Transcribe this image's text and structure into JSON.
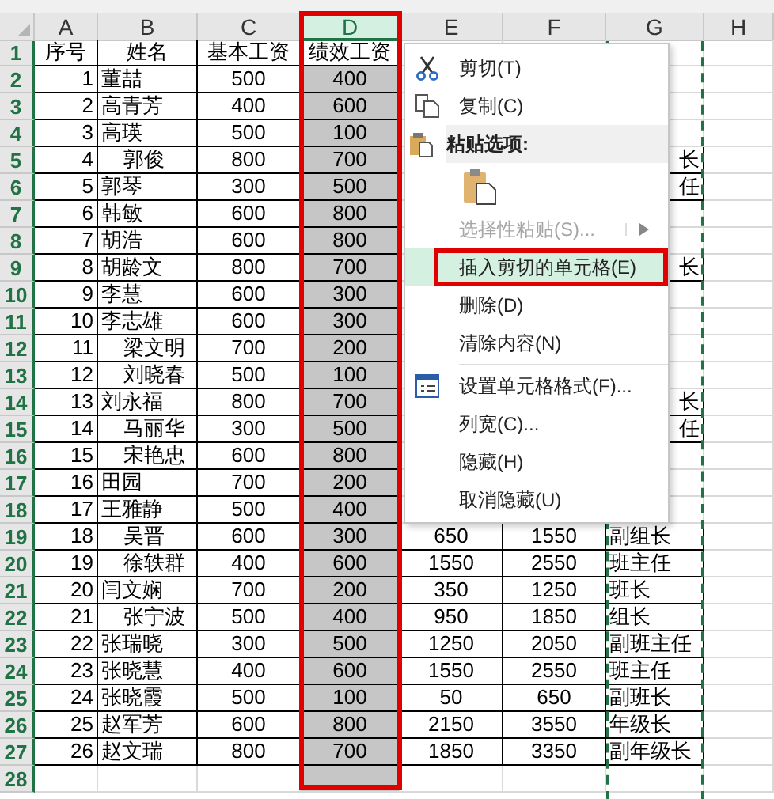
{
  "columns": [
    {
      "label": "A",
      "selected": false
    },
    {
      "label": "B",
      "selected": false
    },
    {
      "label": "C",
      "selected": false
    },
    {
      "label": "D",
      "selected": true,
      "annotated": true
    },
    {
      "label": "E",
      "selected": false
    },
    {
      "label": "F",
      "selected": false
    },
    {
      "label": "G",
      "selected": false,
      "marquee": true
    },
    {
      "label": "H",
      "selected": false
    }
  ],
  "rows": [
    {
      "num": "1",
      "kind": "header",
      "a": "序号",
      "b": "姓名",
      "c": "基本工资",
      "d": "绩效工资"
    },
    {
      "num": "2",
      "kind": "data",
      "a": "1",
      "b": "董喆",
      "c": "500",
      "d": "400"
    },
    {
      "num": "3",
      "kind": "data",
      "a": "2",
      "b": "高青芳",
      "c": "400",
      "d": "600"
    },
    {
      "num": "4",
      "kind": "data",
      "a": "3",
      "b": "高瑛",
      "c": "500",
      "d": "100"
    },
    {
      "num": "5",
      "kind": "data",
      "a": "4",
      "b": "郭俊",
      "indent": true,
      "c": "800",
      "d": "700",
      "g": "长",
      "g_tail": true
    },
    {
      "num": "6",
      "kind": "data",
      "a": "5",
      "b": "郭琴",
      "c": "300",
      "d": "500",
      "g": "任",
      "g_tail": true
    },
    {
      "num": "7",
      "kind": "data",
      "a": "6",
      "b": "韩敏",
      "c": "600",
      "d": "800"
    },
    {
      "num": "8",
      "kind": "data",
      "a": "7",
      "b": "胡浩",
      "c": "600",
      "d": "800"
    },
    {
      "num": "9",
      "kind": "data",
      "a": "8",
      "b": "胡龄文",
      "c": "800",
      "d": "700",
      "g": "长",
      "g_tail": true
    },
    {
      "num": "10",
      "kind": "data",
      "a": "9",
      "b": "李慧",
      "c": "600",
      "d": "300"
    },
    {
      "num": "11",
      "kind": "data",
      "a": "10",
      "b": "李志雄",
      "c": "600",
      "d": "300"
    },
    {
      "num": "12",
      "kind": "data",
      "a": "11",
      "b": "梁文明",
      "indent": true,
      "c": "700",
      "d": "200"
    },
    {
      "num": "13",
      "kind": "data",
      "a": "12",
      "b": "刘晓春",
      "indent": true,
      "c": "500",
      "d": "100"
    },
    {
      "num": "14",
      "kind": "data",
      "a": "13",
      "b": "刘永福",
      "c": "800",
      "d": "700",
      "g": "长",
      "g_tail": true
    },
    {
      "num": "15",
      "kind": "data",
      "a": "14",
      "b": "马丽华",
      "indent": true,
      "c": "300",
      "d": "500",
      "g": "任",
      "g_tail": true
    },
    {
      "num": "16",
      "kind": "data",
      "a": "15",
      "b": "宋艳忠",
      "indent": true,
      "c": "600",
      "d": "800"
    },
    {
      "num": "17",
      "kind": "data",
      "a": "16",
      "b": "田园",
      "c": "700",
      "d": "200"
    },
    {
      "num": "18",
      "kind": "data",
      "a": "17",
      "b": "王雅静",
      "c": "500",
      "d": "400"
    },
    {
      "num": "19",
      "kind": "data",
      "a": "18",
      "b": "吴晋",
      "indent": true,
      "c": "600",
      "d": "300",
      "e": "650",
      "f": "1550",
      "g": "副组长"
    },
    {
      "num": "20",
      "kind": "data",
      "a": "19",
      "b": "徐轶群",
      "indent": true,
      "c": "400",
      "d": "600",
      "e": "1550",
      "f": "2550",
      "g": "班主任"
    },
    {
      "num": "21",
      "kind": "data",
      "a": "20",
      "b": "闫文娴",
      "c": "700",
      "d": "200",
      "e": "350",
      "f": "1250",
      "g": "班长"
    },
    {
      "num": "22",
      "kind": "data",
      "a": "21",
      "b": "张宁波",
      "indent": true,
      "c": "500",
      "d": "400",
      "e": "950",
      "f": "1850",
      "g": "组长"
    },
    {
      "num": "23",
      "kind": "data",
      "a": "22",
      "b": "张瑞晓",
      "c": "300",
      "d": "500",
      "e": "1250",
      "f": "2050",
      "g": "副班主任"
    },
    {
      "num": "24",
      "kind": "data",
      "a": "23",
      "b": "张晓慧",
      "c": "400",
      "d": "600",
      "e": "1550",
      "f": "2550",
      "g": "班主任"
    },
    {
      "num": "25",
      "kind": "data",
      "a": "24",
      "b": "张晓霞",
      "c": "500",
      "d": "100",
      "e": "50",
      "f": "650",
      "g": "副班长"
    },
    {
      "num": "26",
      "kind": "data",
      "a": "25",
      "b": "赵军芳",
      "c": "600",
      "d": "800",
      "e": "2150",
      "f": "3550",
      "g": "年级长"
    },
    {
      "num": "27",
      "kind": "data",
      "a": "26",
      "b": "赵文瑞",
      "c": "800",
      "d": "700",
      "e": "1850",
      "f": "3350",
      "g": "副年级长"
    },
    {
      "num": "28",
      "kind": "empty"
    }
  ],
  "menu": [
    {
      "kind": "cut",
      "label": "剪切(T)",
      "selected": false,
      "disabled": false
    },
    {
      "kind": "copy",
      "label": "复制(C)",
      "selected": false,
      "disabled": false
    },
    {
      "kind": "section",
      "label": "粘贴选项:"
    },
    {
      "kind": "paste"
    },
    {
      "kind": "submenu",
      "label": "选择性粘贴(S)...",
      "selected": false,
      "disabled": true
    },
    {
      "kind": "command",
      "label": "插入剪切的单元格(E)",
      "selected": true,
      "disabled": false,
      "annotated": true
    },
    {
      "kind": "command",
      "label": "删除(D)",
      "selected": false,
      "disabled": false
    },
    {
      "kind": "command",
      "label": "清除内容(N)",
      "selected": false,
      "disabled": false
    },
    {
      "kind": "separator"
    },
    {
      "kind": "format",
      "label": "设置单元格格式(F)...",
      "selected": false,
      "disabled": false
    },
    {
      "kind": "command",
      "label": "列宽(C)...",
      "selected": false,
      "disabled": false
    },
    {
      "kind": "command",
      "label": "隐藏(H)",
      "selected": false,
      "disabled": false
    },
    {
      "kind": "command",
      "label": "取消隐藏(U)",
      "selected": false,
      "disabled": false
    }
  ]
}
